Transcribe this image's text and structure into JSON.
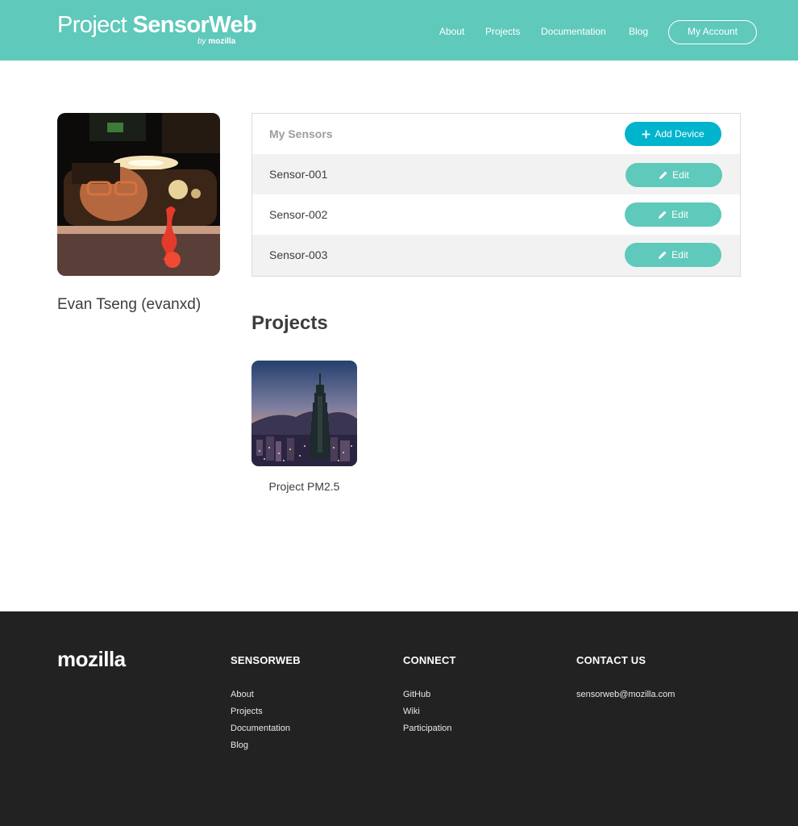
{
  "header": {
    "logo_part1": "Project ",
    "logo_part2": "SensorWeb",
    "logo_by": "by",
    "logo_brand": "mozilla",
    "nav": [
      "About",
      "Projects",
      "Documentation",
      "Blog"
    ],
    "account_button": "My Account"
  },
  "profile": {
    "name": "Evan Tseng (evanxd)"
  },
  "sensors": {
    "title": "My Sensors",
    "add_button": "Add Device",
    "edit_label": "Edit",
    "items": [
      "Sensor-001",
      "Sensor-002",
      "Sensor-003"
    ]
  },
  "projects": {
    "title": "Projects",
    "items": [
      {
        "name": "Project PM2.5"
      }
    ]
  },
  "footer": {
    "logo": "mozilla",
    "columns": [
      {
        "heading": "SENSORWEB",
        "links": [
          "About",
          "Projects",
          "Documentation",
          "Blog"
        ]
      },
      {
        "heading": "CONNECT",
        "links": [
          "GitHub",
          "Wiki",
          "Participation"
        ]
      },
      {
        "heading": "CONTACT US",
        "links": [
          "sensorweb@mozilla.com"
        ]
      }
    ]
  },
  "colors": {
    "header_bg": "#5fc9bb",
    "add_button": "#00b4ce",
    "edit_button": "#5fc9bb",
    "footer_bg": "#222222"
  },
  "icons": {
    "add": "plus-icon",
    "edit": "pencil-icon"
  }
}
